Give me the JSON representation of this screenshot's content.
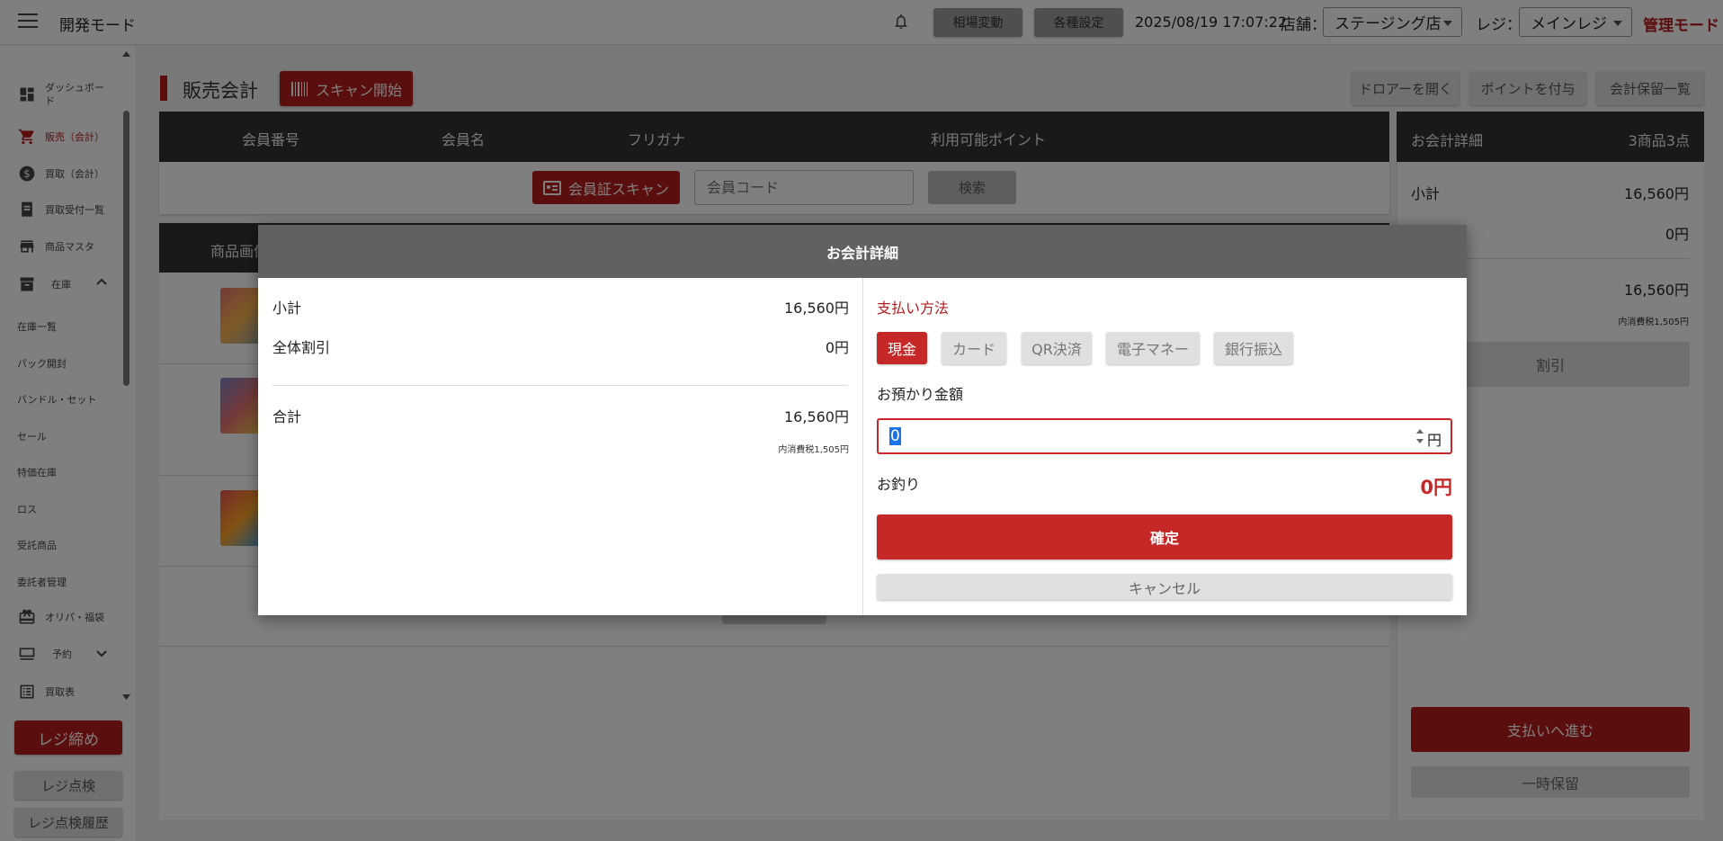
{
  "header": {
    "app_title": "開発モード",
    "market_button": "相場変動",
    "settings_button": "各種設定",
    "datetime": "2025/08/19 17:07:22",
    "store_label": "店舗：",
    "store_value": "ステージング店",
    "register_label": "レジ：",
    "register_value": "メインレジ",
    "mode": "管理モード"
  },
  "sidebar": {
    "items": [
      {
        "label": "ダッシュボード",
        "icon": "dashboard-icon"
      },
      {
        "label": "販売（会計）",
        "icon": "cart-icon",
        "active": true
      },
      {
        "label": "買取（会計）",
        "icon": "dollar-icon"
      },
      {
        "label": "買取受付一覧",
        "icon": "receipt-icon"
      },
      {
        "label": "商品マスタ",
        "icon": "store-icon"
      },
      {
        "label": "在庫",
        "icon": "archive-icon"
      }
    ],
    "sub_items": [
      "在庫一覧",
      "パック開封",
      "バンドル・セット",
      "セール",
      "特価在庫",
      "ロス",
      "受託商品",
      "委託者管理"
    ],
    "bottom_items": [
      {
        "label": "オリパ・福袋",
        "icon": "gift-icon"
      },
      {
        "label": "予約",
        "icon": "pos-icon"
      },
      {
        "label": "買取表",
        "icon": "list-icon"
      }
    ],
    "close_register": "レジ締め",
    "register_check": "レジ点検",
    "register_history": "レジ点検履歴"
  },
  "main": {
    "title": "販売会計",
    "scan_button": "スキャン開始",
    "open_drawer": "ドロアーを開く",
    "add_points": "ポイントを付与",
    "held_list": "会計保留一覧",
    "member_headers": [
      "会員番号",
      "会員名",
      "フリガナ",
      "利用可能ポイント"
    ],
    "card_scan_button": "会員証スキャン",
    "member_code_placeholder": "会員コード",
    "search_button": "検索",
    "product_header": "商品画像"
  },
  "detail": {
    "title": "お会計詳細",
    "count": "3商品3点",
    "subtotal_label": "小計",
    "subtotal": "16,560円",
    "discount": "0円",
    "total": "16,560円",
    "tax": "内消費税1,505円",
    "discount_button": "割引",
    "pay_button": "支払いへ進む",
    "hold_button": "一時保留"
  },
  "modal": {
    "title": "お会計詳細",
    "subtotal_label": "小計",
    "subtotal": "16,560円",
    "overall_discount_label": "全体割引",
    "overall_discount": "0円",
    "total_label": "合計",
    "total": "16,560円",
    "tax": "内消費税1,505円",
    "payment_method_label": "支払い方法",
    "payment_methods": [
      "現金",
      "カード",
      "QR決済",
      "電子マネー",
      "銀行振込"
    ],
    "selected_method": "現金",
    "deposit_label": "お預かり金額",
    "deposit_value": "0",
    "yen": "円",
    "change_label": "お釣り",
    "change_value": "0円",
    "confirm_button": "確定",
    "cancel_button": "キャンセル"
  },
  "colors": {
    "accent": "#c62828",
    "header_dark": "#333333",
    "modal_header": "#616161"
  }
}
